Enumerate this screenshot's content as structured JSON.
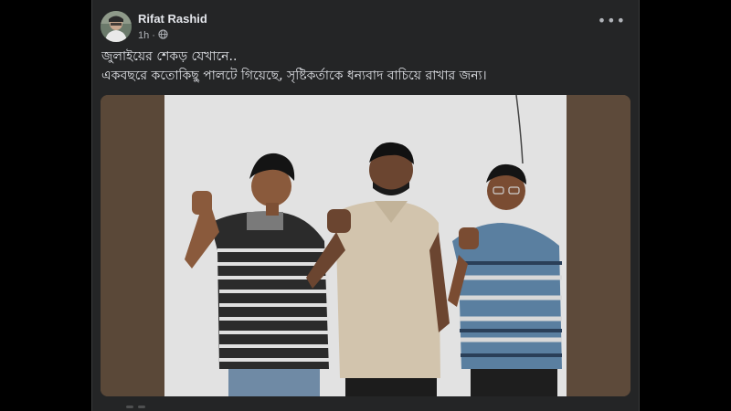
{
  "post": {
    "author": "Rifat Rashid",
    "timestamp": "1h",
    "privacy_icon": "globe-icon",
    "more_icon": "more-horizontal-icon",
    "caption_lines": [
      "জুলাইয়ের শেকড় যেখানে..",
      "একবছরে কতোকিছু পালটে গিয়েছে, সৃষ্টিকর্তাকে ধন্যবাদ বাচিয়ে রাখার জন্য।"
    ]
  },
  "colors": {
    "page_bg": "#000000",
    "card_bg": "#242526",
    "text_primary": "#e4e6eb",
    "text_secondary": "#b0b3b8"
  }
}
